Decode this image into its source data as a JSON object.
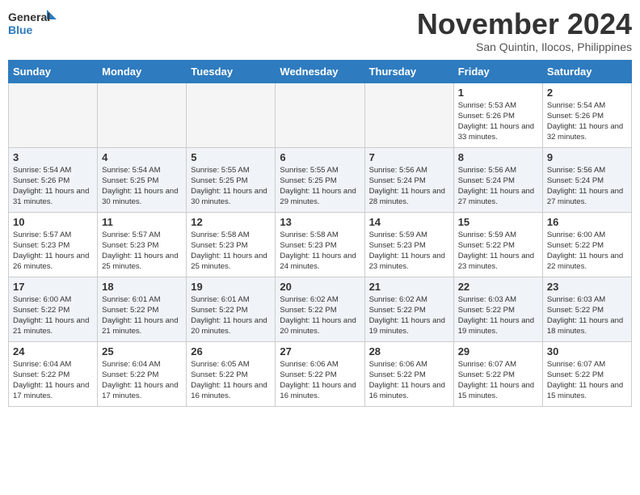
{
  "header": {
    "logo_general": "General",
    "logo_blue": "Blue",
    "month_title": "November 2024",
    "location": "San Quintin, Ilocos, Philippines"
  },
  "weekdays": [
    "Sunday",
    "Monday",
    "Tuesday",
    "Wednesday",
    "Thursday",
    "Friday",
    "Saturday"
  ],
  "weeks": [
    [
      {
        "day": "",
        "info": ""
      },
      {
        "day": "",
        "info": ""
      },
      {
        "day": "",
        "info": ""
      },
      {
        "day": "",
        "info": ""
      },
      {
        "day": "",
        "info": ""
      },
      {
        "day": "1",
        "info": "Sunrise: 5:53 AM\nSunset: 5:26 PM\nDaylight: 11 hours and 33 minutes."
      },
      {
        "day": "2",
        "info": "Sunrise: 5:54 AM\nSunset: 5:26 PM\nDaylight: 11 hours and 32 minutes."
      }
    ],
    [
      {
        "day": "3",
        "info": "Sunrise: 5:54 AM\nSunset: 5:26 PM\nDaylight: 11 hours and 31 minutes."
      },
      {
        "day": "4",
        "info": "Sunrise: 5:54 AM\nSunset: 5:25 PM\nDaylight: 11 hours and 30 minutes."
      },
      {
        "day": "5",
        "info": "Sunrise: 5:55 AM\nSunset: 5:25 PM\nDaylight: 11 hours and 30 minutes."
      },
      {
        "day": "6",
        "info": "Sunrise: 5:55 AM\nSunset: 5:25 PM\nDaylight: 11 hours and 29 minutes."
      },
      {
        "day": "7",
        "info": "Sunrise: 5:56 AM\nSunset: 5:24 PM\nDaylight: 11 hours and 28 minutes."
      },
      {
        "day": "8",
        "info": "Sunrise: 5:56 AM\nSunset: 5:24 PM\nDaylight: 11 hours and 27 minutes."
      },
      {
        "day": "9",
        "info": "Sunrise: 5:56 AM\nSunset: 5:24 PM\nDaylight: 11 hours and 27 minutes."
      }
    ],
    [
      {
        "day": "10",
        "info": "Sunrise: 5:57 AM\nSunset: 5:23 PM\nDaylight: 11 hours and 26 minutes."
      },
      {
        "day": "11",
        "info": "Sunrise: 5:57 AM\nSunset: 5:23 PM\nDaylight: 11 hours and 25 minutes."
      },
      {
        "day": "12",
        "info": "Sunrise: 5:58 AM\nSunset: 5:23 PM\nDaylight: 11 hours and 25 minutes."
      },
      {
        "day": "13",
        "info": "Sunrise: 5:58 AM\nSunset: 5:23 PM\nDaylight: 11 hours and 24 minutes."
      },
      {
        "day": "14",
        "info": "Sunrise: 5:59 AM\nSunset: 5:23 PM\nDaylight: 11 hours and 23 minutes."
      },
      {
        "day": "15",
        "info": "Sunrise: 5:59 AM\nSunset: 5:22 PM\nDaylight: 11 hours and 23 minutes."
      },
      {
        "day": "16",
        "info": "Sunrise: 6:00 AM\nSunset: 5:22 PM\nDaylight: 11 hours and 22 minutes."
      }
    ],
    [
      {
        "day": "17",
        "info": "Sunrise: 6:00 AM\nSunset: 5:22 PM\nDaylight: 11 hours and 21 minutes."
      },
      {
        "day": "18",
        "info": "Sunrise: 6:01 AM\nSunset: 5:22 PM\nDaylight: 11 hours and 21 minutes."
      },
      {
        "day": "19",
        "info": "Sunrise: 6:01 AM\nSunset: 5:22 PM\nDaylight: 11 hours and 20 minutes."
      },
      {
        "day": "20",
        "info": "Sunrise: 6:02 AM\nSunset: 5:22 PM\nDaylight: 11 hours and 20 minutes."
      },
      {
        "day": "21",
        "info": "Sunrise: 6:02 AM\nSunset: 5:22 PM\nDaylight: 11 hours and 19 minutes."
      },
      {
        "day": "22",
        "info": "Sunrise: 6:03 AM\nSunset: 5:22 PM\nDaylight: 11 hours and 19 minutes."
      },
      {
        "day": "23",
        "info": "Sunrise: 6:03 AM\nSunset: 5:22 PM\nDaylight: 11 hours and 18 minutes."
      }
    ],
    [
      {
        "day": "24",
        "info": "Sunrise: 6:04 AM\nSunset: 5:22 PM\nDaylight: 11 hours and 17 minutes."
      },
      {
        "day": "25",
        "info": "Sunrise: 6:04 AM\nSunset: 5:22 PM\nDaylight: 11 hours and 17 minutes."
      },
      {
        "day": "26",
        "info": "Sunrise: 6:05 AM\nSunset: 5:22 PM\nDaylight: 11 hours and 16 minutes."
      },
      {
        "day": "27",
        "info": "Sunrise: 6:06 AM\nSunset: 5:22 PM\nDaylight: 11 hours and 16 minutes."
      },
      {
        "day": "28",
        "info": "Sunrise: 6:06 AM\nSunset: 5:22 PM\nDaylight: 11 hours and 16 minutes."
      },
      {
        "day": "29",
        "info": "Sunrise: 6:07 AM\nSunset: 5:22 PM\nDaylight: 11 hours and 15 minutes."
      },
      {
        "day": "30",
        "info": "Sunrise: 6:07 AM\nSunset: 5:22 PM\nDaylight: 11 hours and 15 minutes."
      }
    ]
  ]
}
